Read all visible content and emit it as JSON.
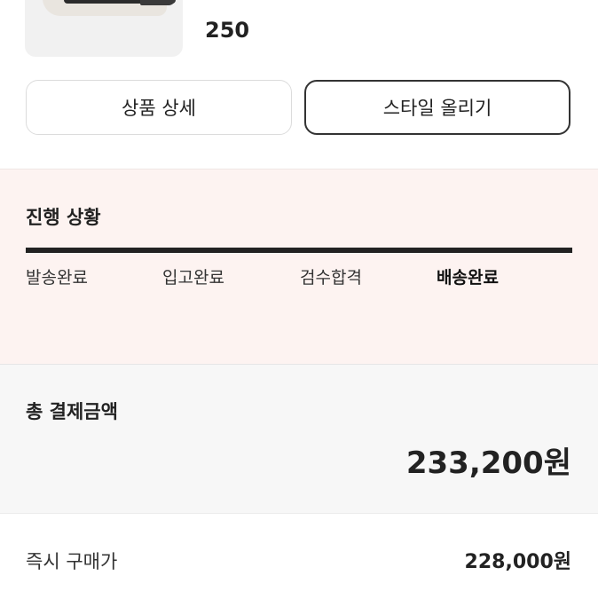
{
  "product": {
    "size": "250"
  },
  "buttons": {
    "detail_label": "상품 상세",
    "style_label": "스타일 올리기"
  },
  "progress": {
    "title": "진행 상황",
    "steps": [
      "발송완료",
      "입고완료",
      "검수합격",
      "배송완료"
    ],
    "active_step": "배송완료"
  },
  "payment": {
    "total_label": "총 결제금액",
    "total_value": "233,200원",
    "instant_price_label": "즉시 구매가",
    "instant_price_value": "228,000원"
  },
  "colors": {
    "progress_bg": "#fdf3f1",
    "total_bg": "#f7f7f7",
    "bar": "#222222"
  }
}
